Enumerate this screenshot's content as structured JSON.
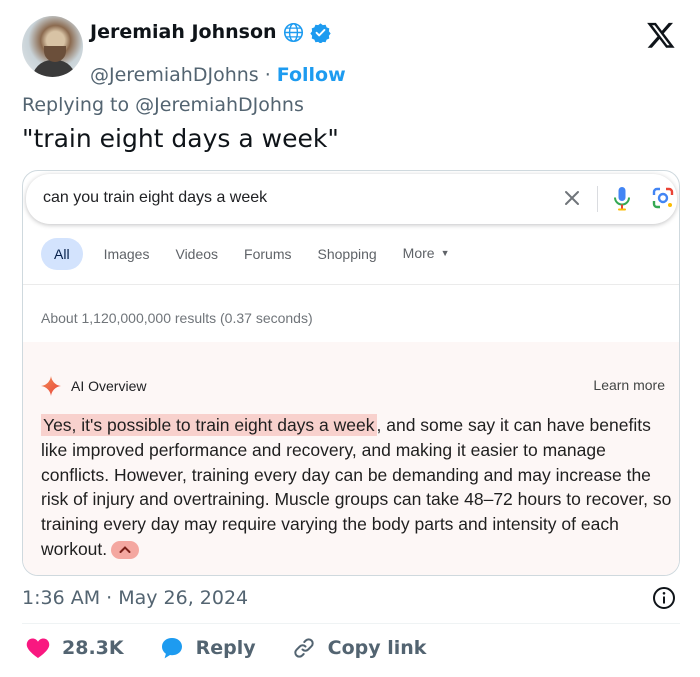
{
  "author": {
    "name": "Jeremiah Johnson",
    "handle": "@JeremiahDJohns",
    "separator": "·",
    "follow_label": "Follow"
  },
  "icons": {
    "globe": "globe-icon",
    "verified": "verified-badge-icon",
    "brand": "x-logo-icon",
    "info": "info-icon",
    "like": "heart-icon",
    "reply": "reply-bubble-icon",
    "copy": "link-icon"
  },
  "colors": {
    "accent": "#1d9bf0",
    "like": "#f91880",
    "highlight": "#f8d1cd",
    "ai_panel_bg": "#fdf7f6"
  },
  "replying": {
    "prefix": "Replying to",
    "mention": "@JeremiahDJohns"
  },
  "tweet_text": "\"train eight days a week\"",
  "search": {
    "query": "can you train eight days a week",
    "tabs": [
      "All",
      "Images",
      "Videos",
      "Forums",
      "Shopping",
      "More"
    ],
    "active_tab": "All",
    "results_count": "About 1,120,000,000 results (0.37 seconds)"
  },
  "ai_overview": {
    "label": "AI Overview",
    "learn_more": "Learn more",
    "highlight": "Yes, it's possible to train eight days a week",
    "body": ", and some say it can have benefits like improved performance and recovery, and making it easier to manage conflicts. However, training every day can be demanding and may increase the risk of injury and overtraining. Muscle groups can take 48–72 hours to recover, so training every day may require varying the body parts and intensity of each workout."
  },
  "meta": {
    "timestamp": "1:36 AM · May 26, 2024"
  },
  "actions": {
    "likes": "28.3K",
    "reply_label": "Reply",
    "copy_label": "Copy link"
  }
}
